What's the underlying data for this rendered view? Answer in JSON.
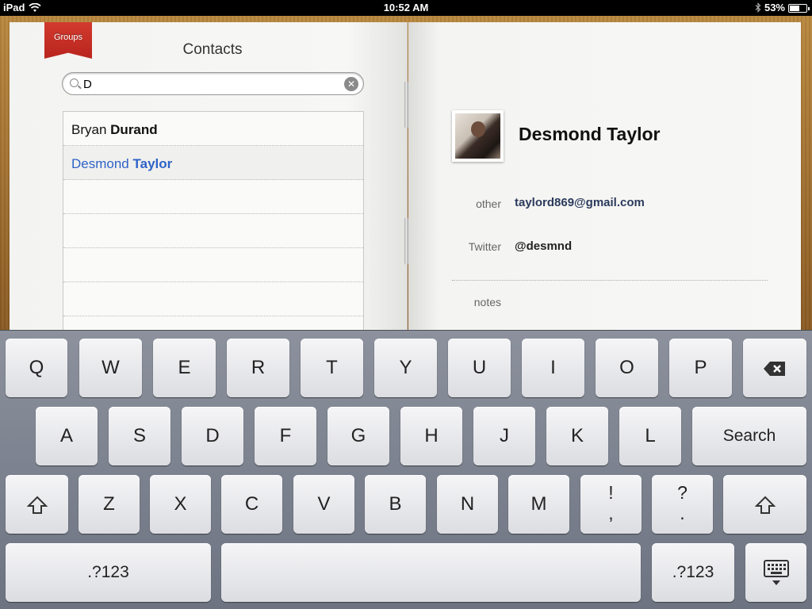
{
  "status_bar": {
    "device": "iPad",
    "time": "10:52 AM",
    "battery": "53%",
    "battery_level": 0.53
  },
  "sidebar": {
    "groups_label": "Groups",
    "title": "Contacts",
    "search": {
      "value": "D",
      "placeholder": ""
    },
    "contacts": [
      {
        "first": "Bryan",
        "last": "Durand",
        "selected": false
      },
      {
        "first": "Desmond",
        "last": "Taylor",
        "selected": true
      }
    ]
  },
  "detail": {
    "name": "Desmond Taylor",
    "fields": [
      {
        "label": "other",
        "value": "taylord869@gmail.com"
      },
      {
        "label": "Twitter",
        "value": "@desmnd"
      }
    ],
    "notes_label": "notes"
  },
  "keyboard": {
    "row1": [
      "Q",
      "W",
      "E",
      "R",
      "T",
      "Y",
      "U",
      "I",
      "O",
      "P"
    ],
    "row2": [
      "A",
      "S",
      "D",
      "F",
      "G",
      "H",
      "J",
      "K",
      "L"
    ],
    "row3": [
      "Z",
      "X",
      "C",
      "V",
      "B",
      "N",
      "M"
    ],
    "search_label": "Search",
    "numbers_label": ".?123",
    "punct1_top": "!",
    "punct1_bottom": ",",
    "punct2_top": "?",
    "punct2_bottom": "."
  }
}
